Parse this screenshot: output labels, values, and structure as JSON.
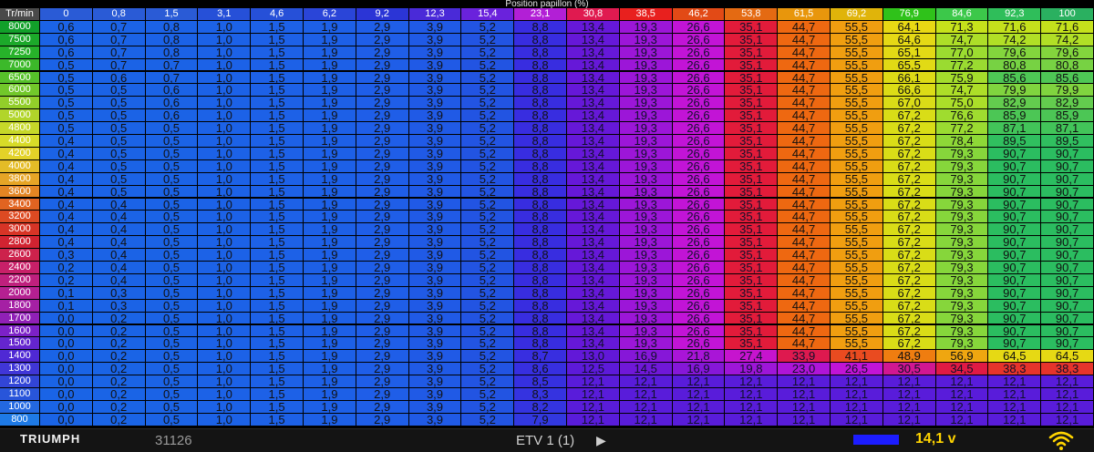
{
  "axis_title": "Position papillon (%)",
  "corner_label": "Tr/min",
  "throttle": [
    "0",
    "0,8",
    "1,5",
    "3,1",
    "4,6",
    "6,2",
    "9,2",
    "12,3",
    "15,4",
    "23,1",
    "30,8",
    "38,5",
    "46,2",
    "53,8",
    "61,5",
    "69,2",
    "76,9",
    "84,6",
    "92,3",
    "100"
  ],
  "rpm": [
    "8000",
    "7500",
    "7250",
    "7000",
    "6500",
    "6000",
    "5500",
    "5000",
    "4800",
    "4400",
    "4200",
    "4000",
    "3800",
    "3600",
    "3400",
    "3200",
    "3000",
    "2800",
    "2600",
    "2400",
    "2200",
    "2000",
    "1800",
    "1700",
    "1600",
    "1500",
    "1400",
    "1300",
    "1200",
    "1100",
    "1000",
    "800"
  ],
  "table": [
    [
      "0,6",
      "0,7",
      "0,8",
      "1,0",
      "1,5",
      "1,9",
      "2,9",
      "3,9",
      "5,2",
      "8,8",
      "13,4",
      "19,3",
      "26,6",
      "35,1",
      "44,7",
      "55,5",
      "64,1",
      "71,3",
      "71,6",
      "71,6"
    ],
    [
      "0,6",
      "0,7",
      "0,8",
      "1,0",
      "1,5",
      "1,9",
      "2,9",
      "3,9",
      "5,2",
      "8,8",
      "13,4",
      "19,3",
      "26,6",
      "35,1",
      "44,7",
      "55,5",
      "64,6",
      "74,7",
      "74,2",
      "74,2"
    ],
    [
      "0,6",
      "0,7",
      "0,8",
      "1,0",
      "1,5",
      "1,9",
      "2,9",
      "3,9",
      "5,2",
      "8,8",
      "13,4",
      "19,3",
      "26,6",
      "35,1",
      "44,7",
      "55,5",
      "65,1",
      "77,0",
      "79,6",
      "79,6"
    ],
    [
      "0,5",
      "0,7",
      "0,7",
      "1,0",
      "1,5",
      "1,9",
      "2,9",
      "3,9",
      "5,2",
      "8,8",
      "13,4",
      "19,3",
      "26,6",
      "35,1",
      "44,7",
      "55,5",
      "65,5",
      "77,2",
      "80,8",
      "80,8"
    ],
    [
      "0,5",
      "0,6",
      "0,7",
      "1,0",
      "1,5",
      "1,9",
      "2,9",
      "3,9",
      "5,2",
      "8,8",
      "13,4",
      "19,3",
      "26,6",
      "35,1",
      "44,7",
      "55,5",
      "66,1",
      "75,9",
      "85,6",
      "85,6"
    ],
    [
      "0,5",
      "0,5",
      "0,6",
      "1,0",
      "1,5",
      "1,9",
      "2,9",
      "3,9",
      "5,2",
      "8,8",
      "13,4",
      "19,3",
      "26,6",
      "35,1",
      "44,7",
      "55,5",
      "66,6",
      "74,7",
      "79,9",
      "79,9"
    ],
    [
      "0,5",
      "0,5",
      "0,6",
      "1,0",
      "1,5",
      "1,9",
      "2,9",
      "3,9",
      "5,2",
      "8,8",
      "13,4",
      "19,3",
      "26,6",
      "35,1",
      "44,7",
      "55,5",
      "67,0",
      "75,0",
      "82,9",
      "82,9"
    ],
    [
      "0,5",
      "0,5",
      "0,6",
      "1,0",
      "1,5",
      "1,9",
      "2,9",
      "3,9",
      "5,2",
      "8,8",
      "13,4",
      "19,3",
      "26,6",
      "35,1",
      "44,7",
      "55,5",
      "67,2",
      "76,6",
      "85,9",
      "85,9"
    ],
    [
      "0,5",
      "0,5",
      "0,5",
      "1,0",
      "1,5",
      "1,9",
      "2,9",
      "3,9",
      "5,2",
      "8,8",
      "13,4",
      "19,3",
      "26,6",
      "35,1",
      "44,7",
      "55,5",
      "67,2",
      "77,2",
      "87,1",
      "87,1"
    ],
    [
      "0,4",
      "0,5",
      "0,5",
      "1,0",
      "1,5",
      "1,9",
      "2,9",
      "3,9",
      "5,2",
      "8,8",
      "13,4",
      "19,3",
      "26,6",
      "35,1",
      "44,7",
      "55,5",
      "67,2",
      "78,4",
      "89,5",
      "89,5"
    ],
    [
      "0,4",
      "0,5",
      "0,5",
      "1,0",
      "1,5",
      "1,9",
      "2,9",
      "3,9",
      "5,2",
      "8,8",
      "13,4",
      "19,3",
      "26,6",
      "35,1",
      "44,7",
      "55,5",
      "67,2",
      "79,3",
      "90,7",
      "90,7"
    ],
    [
      "0,4",
      "0,5",
      "0,5",
      "1,0",
      "1,5",
      "1,9",
      "2,9",
      "3,9",
      "5,2",
      "8,8",
      "13,4",
      "19,3",
      "26,6",
      "35,1",
      "44,7",
      "55,5",
      "67,2",
      "79,3",
      "90,7",
      "90,7"
    ],
    [
      "0,4",
      "0,5",
      "0,5",
      "1,0",
      "1,5",
      "1,9",
      "2,9",
      "3,9",
      "5,2",
      "8,8",
      "13,4",
      "19,3",
      "26,6",
      "35,1",
      "44,7",
      "55,5",
      "67,2",
      "79,3",
      "90,7",
      "90,7"
    ],
    [
      "0,4",
      "0,5",
      "0,5",
      "1,0",
      "1,5",
      "1,9",
      "2,9",
      "3,9",
      "5,2",
      "8,8",
      "13,4",
      "19,3",
      "26,6",
      "35,1",
      "44,7",
      "55,5",
      "67,2",
      "79,3",
      "90,7",
      "90,7"
    ],
    [
      "0,4",
      "0,4",
      "0,5",
      "1,0",
      "1,5",
      "1,9",
      "2,9",
      "3,9",
      "5,2",
      "8,8",
      "13,4",
      "19,3",
      "26,6",
      "35,1",
      "44,7",
      "55,5",
      "67,2",
      "79,3",
      "90,7",
      "90,7"
    ],
    [
      "0,4",
      "0,4",
      "0,5",
      "1,0",
      "1,5",
      "1,9",
      "2,9",
      "3,9",
      "5,2",
      "8,8",
      "13,4",
      "19,3",
      "26,6",
      "35,1",
      "44,7",
      "55,5",
      "67,2",
      "79,3",
      "90,7",
      "90,7"
    ],
    [
      "0,4",
      "0,4",
      "0,5",
      "1,0",
      "1,5",
      "1,9",
      "2,9",
      "3,9",
      "5,2",
      "8,8",
      "13,4",
      "19,3",
      "26,6",
      "35,1",
      "44,7",
      "55,5",
      "67,2",
      "79,3",
      "90,7",
      "90,7"
    ],
    [
      "0,4",
      "0,4",
      "0,5",
      "1,0",
      "1,5",
      "1,9",
      "2,9",
      "3,9",
      "5,2",
      "8,8",
      "13,4",
      "19,3",
      "26,6",
      "35,1",
      "44,7",
      "55,5",
      "67,2",
      "79,3",
      "90,7",
      "90,7"
    ],
    [
      "0,3",
      "0,4",
      "0,5",
      "1,0",
      "1,5",
      "1,9",
      "2,9",
      "3,9",
      "5,2",
      "8,8",
      "13,4",
      "19,3",
      "26,6",
      "35,1",
      "44,7",
      "55,5",
      "67,2",
      "79,3",
      "90,7",
      "90,7"
    ],
    [
      "0,2",
      "0,4",
      "0,5",
      "1,0",
      "1,5",
      "1,9",
      "2,9",
      "3,9",
      "5,2",
      "8,8",
      "13,4",
      "19,3",
      "26,6",
      "35,1",
      "44,7",
      "55,5",
      "67,2",
      "79,3",
      "90,7",
      "90,7"
    ],
    [
      "0,2",
      "0,4",
      "0,5",
      "1,0",
      "1,5",
      "1,9",
      "2,9",
      "3,9",
      "5,2",
      "8,8",
      "13,4",
      "19,3",
      "26,6",
      "35,1",
      "44,7",
      "55,5",
      "67,2",
      "79,3",
      "90,7",
      "90,7"
    ],
    [
      "0,1",
      "0,3",
      "0,5",
      "1,0",
      "1,5",
      "1,9",
      "2,9",
      "3,9",
      "5,2",
      "8,8",
      "13,4",
      "19,3",
      "26,6",
      "35,1",
      "44,7",
      "55,5",
      "67,2",
      "79,3",
      "90,7",
      "90,7"
    ],
    [
      "0,1",
      "0,3",
      "0,5",
      "1,0",
      "1,5",
      "1,9",
      "2,9",
      "3,9",
      "5,2",
      "8,8",
      "13,4",
      "19,3",
      "26,6",
      "35,1",
      "44,7",
      "55,5",
      "67,2",
      "79,3",
      "90,7",
      "90,7"
    ],
    [
      "0,0",
      "0,2",
      "0,5",
      "1,0",
      "1,5",
      "1,9",
      "2,9",
      "3,9",
      "5,2",
      "8,8",
      "13,4",
      "19,3",
      "26,6",
      "35,1",
      "44,7",
      "55,5",
      "67,2",
      "79,3",
      "90,7",
      "90,7"
    ],
    [
      "0,0",
      "0,2",
      "0,5",
      "1,0",
      "1,5",
      "1,9",
      "2,9",
      "3,9",
      "5,2",
      "8,8",
      "13,4",
      "19,3",
      "26,6",
      "35,1",
      "44,7",
      "55,5",
      "67,2",
      "79,3",
      "90,7",
      "90,7"
    ],
    [
      "0,0",
      "0,2",
      "0,5",
      "1,0",
      "1,5",
      "1,9",
      "2,9",
      "3,9",
      "5,2",
      "8,8",
      "13,4",
      "19,3",
      "26,6",
      "35,1",
      "44,7",
      "55,5",
      "67,2",
      "79,3",
      "90,7",
      "90,7"
    ],
    [
      "0,0",
      "0,2",
      "0,5",
      "1,0",
      "1,5",
      "1,9",
      "2,9",
      "3,9",
      "5,2",
      "8,7",
      "13,0",
      "16,9",
      "21,8",
      "27,4",
      "33,9",
      "41,1",
      "48,9",
      "56,9",
      "64,5",
      "64,5"
    ],
    [
      "0,0",
      "0,2",
      "0,5",
      "1,0",
      "1,5",
      "1,9",
      "2,9",
      "3,9",
      "5,2",
      "8,6",
      "12,5",
      "14,5",
      "16,9",
      "19,8",
      "23,0",
      "26,5",
      "30,5",
      "34,5",
      "38,3",
      "38,3"
    ],
    [
      "0,0",
      "0,2",
      "0,5",
      "1,0",
      "1,5",
      "1,9",
      "2,9",
      "3,9",
      "5,2",
      "8,5",
      "12,1",
      "12,1",
      "12,1",
      "12,1",
      "12,1",
      "12,1",
      "12,1",
      "12,1",
      "12,1",
      "12,1"
    ],
    [
      "0,0",
      "0,2",
      "0,5",
      "1,0",
      "1,5",
      "1,9",
      "2,9",
      "3,9",
      "5,2",
      "8,3",
      "12,1",
      "12,1",
      "12,1",
      "12,1",
      "12,1",
      "12,1",
      "12,1",
      "12,1",
      "12,1",
      "12,1"
    ],
    [
      "0,0",
      "0,2",
      "0,5",
      "1,0",
      "1,5",
      "1,9",
      "2,9",
      "3,9",
      "5,2",
      "8,2",
      "12,1",
      "12,1",
      "12,1",
      "12,1",
      "12,1",
      "12,1",
      "12,1",
      "12,1",
      "12,1",
      "12,1"
    ],
    [
      "0,0",
      "0,2",
      "0,5",
      "1,0",
      "1,5",
      "1,9",
      "2,9",
      "3,9",
      "5,2",
      "7,9",
      "12,1",
      "12,1",
      "12,1",
      "12,1",
      "12,1",
      "12,1",
      "12,1",
      "12,1",
      "12,1",
      "12,1"
    ]
  ],
  "colors": {
    "header": [
      "#2a5bd6",
      "#2a5bd6",
      "#2a5bd6",
      "#2650d8",
      "#2650d8",
      "#2a45d8",
      "#2b35d6",
      "#4a2ad8",
      "#6a22dc",
      "#b21fd6",
      "#e01a50",
      "#e8201e",
      "#e24a16",
      "#e46a12",
      "#e8960c",
      "#e0b40a",
      "#2fc21a",
      "#3cc84a",
      "#2fbe5a",
      "#2ab060"
    ],
    "rpm_gradient": [
      "#12a02a",
      "#2bb52a",
      "#6bc62a",
      "#b6d62a",
      "#e2dc28",
      "#e6a826",
      "#e05a20",
      "#d42428",
      "#c8206a",
      "#b0209a",
      "#7f20c6",
      "#4a2ad6",
      "#2a4ed8",
      "#1e7ae6"
    ]
  },
  "footer": {
    "brand": "TRIUMPH",
    "serial": "31126",
    "etv": "ETV 1 (1)",
    "play_icon": "play-icon",
    "voltage": "14,1 v",
    "voltage_level": 1.0,
    "wifi_icon": "wifi-icon"
  }
}
